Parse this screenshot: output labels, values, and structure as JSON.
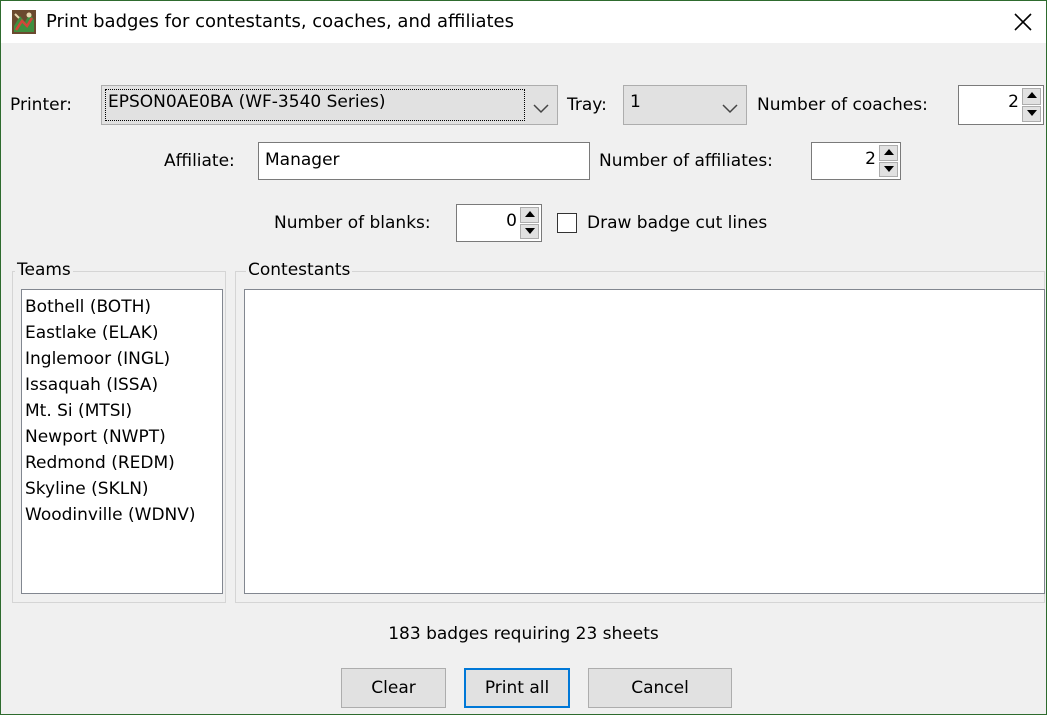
{
  "window": {
    "title": "Print badges for contestants, coaches, and affiliates"
  },
  "printer": {
    "label": "Printer:",
    "selected": "EPSON0AE0BA (WF-3540 Series)"
  },
  "tray": {
    "label": "Tray:",
    "selected": "1"
  },
  "coaches": {
    "label": "Number of coaches:",
    "value": "2"
  },
  "affiliate": {
    "label": "Affiliate:",
    "value": "Manager"
  },
  "affiliates_count": {
    "label": "Number of affiliates:",
    "value": "2"
  },
  "blanks": {
    "label": "Number of blanks:",
    "value": "0"
  },
  "cut_lines": {
    "label": "Draw badge cut lines",
    "checked": false
  },
  "teams": {
    "title": "Teams",
    "items": [
      "Bothell (BOTH)",
      "Eastlake (ELAK)",
      "Inglemoor (INGL)",
      "Issaquah (ISSA)",
      "Mt. Si (MTSI)",
      "Newport (NWPT)",
      "Redmond (REDM)",
      "Skyline (SKLN)",
      "Woodinville (WDNV)"
    ]
  },
  "contestants": {
    "title": "Contestants",
    "items": []
  },
  "status": "183 badges requiring 23 sheets",
  "buttons": {
    "clear": "Clear",
    "print_all": "Print all",
    "cancel": "Cancel"
  },
  "colors": {
    "window_border": "#2e6b2e",
    "default_button_border": "#0078d7",
    "dialog_background": "#f0f0f0"
  },
  "icons": {
    "app": "app-icon",
    "close": "close-icon",
    "dropdown": "chevron-down-icon",
    "spin_up": "spin-up-icon",
    "spin_down": "spin-down-icon"
  }
}
